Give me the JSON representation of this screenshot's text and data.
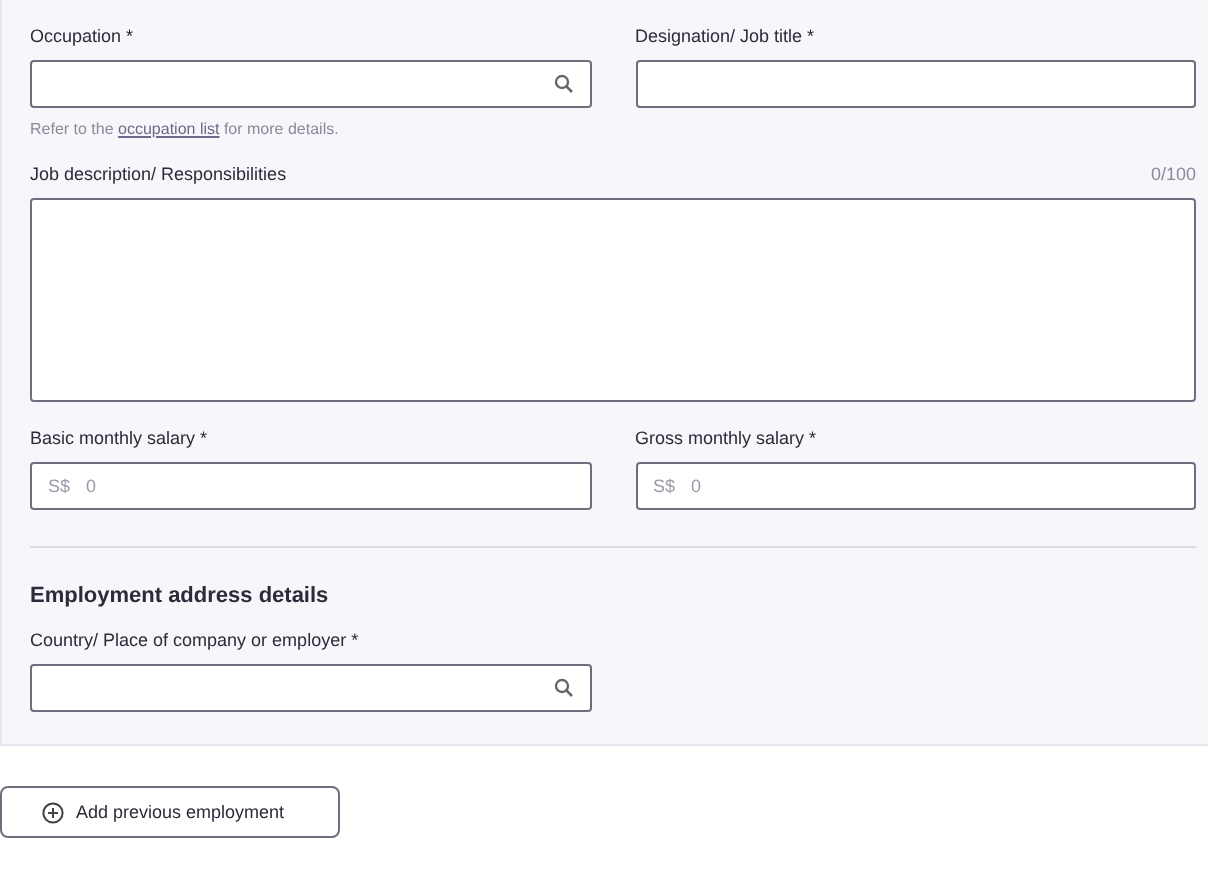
{
  "rows": [
    {
      "fields": [
        {
          "kind": "search",
          "label": "Occupation *",
          "hint": {
            "before": "Refer to the ",
            "link": "occupation list",
            "after": " for more details."
          }
        },
        {
          "kind": "text",
          "label": "Designation/ Job title *"
        }
      ]
    },
    {
      "fields": [
        {
          "kind": "textarea",
          "label": "Job description/ Responsibilities",
          "counter": "0/100"
        }
      ]
    },
    {
      "fields": [
        {
          "kind": "currency",
          "label": "Basic monthly salary *",
          "prefix": "S$",
          "placeholder": "0"
        },
        {
          "kind": "currency",
          "label": "Gross monthly salary *",
          "prefix": "S$",
          "placeholder": "0"
        }
      ]
    }
  ],
  "address": {
    "heading": "Employment address details",
    "fields": [
      {
        "kind": "search",
        "label": "Country/ Place of company or employer *"
      }
    ]
  },
  "add_button": {
    "label": "Add previous employment"
  }
}
